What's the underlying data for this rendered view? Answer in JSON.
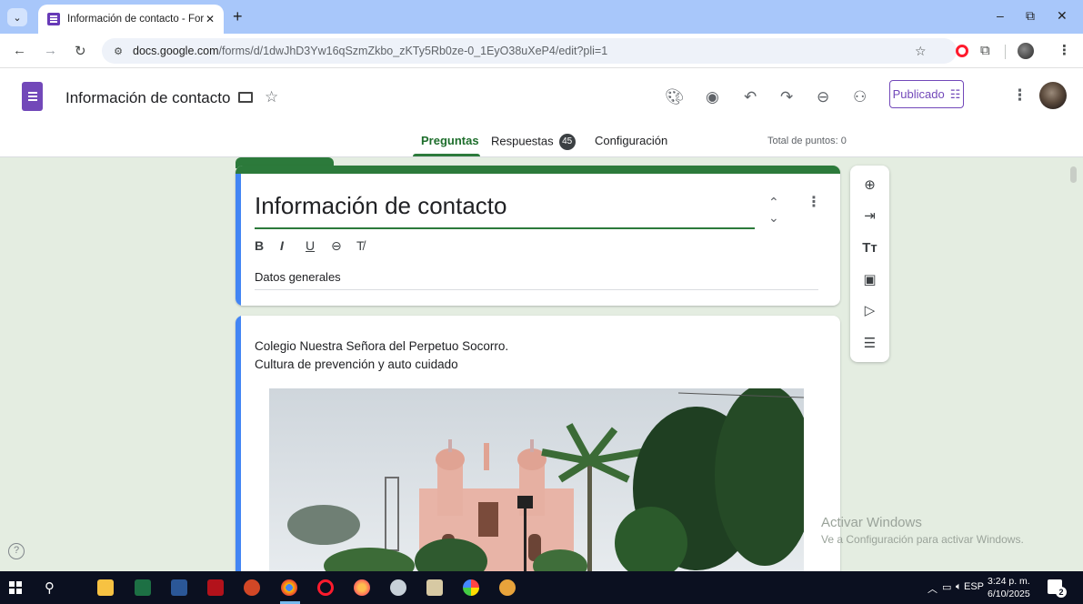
{
  "browser": {
    "tab_title": "Información de contacto - Form",
    "tab_close": "✕",
    "new_tab": "+",
    "url_host": "docs.google.com",
    "url_path": "/forms/d/1dwJhD3Yw16qSzmZkbo_zKTy5Rb0ze-0_1EyO38uXeP4/edit?pli=1",
    "window_controls": [
      "–",
      "⧉",
      "✕"
    ]
  },
  "forms_header": {
    "doc_title": "Información de contacto",
    "publish_label": "Publicado",
    "tabs": [
      {
        "label": "Preguntas",
        "active": true
      },
      {
        "label": "Respuestas",
        "badge": "45"
      },
      {
        "label": "Configuración"
      }
    ],
    "total_points": "Total de puntos: 0"
  },
  "title_card": {
    "title": "Información de contacto",
    "format_buttons": [
      "B",
      "I",
      "U"
    ],
    "description": "Datos generales"
  },
  "content_card": {
    "line1": "Colegio Nuestra Señora del Perpetuo Socorro.",
    "line2": "Cultura de prevención y auto cuidado"
  },
  "watermark": {
    "line1": "Activar Windows",
    "line2": "Ve a Configuración para activar Windows."
  },
  "taskbar": {
    "language": "ESP",
    "time": "3:24 p. m.",
    "date": "6/10/2025",
    "notifications": "2"
  },
  "colors": {
    "accent_green": "#2c7a3b",
    "forms_purple": "#7248b9",
    "background": "#e4ede1",
    "card_left_bar": "#4285f4"
  }
}
